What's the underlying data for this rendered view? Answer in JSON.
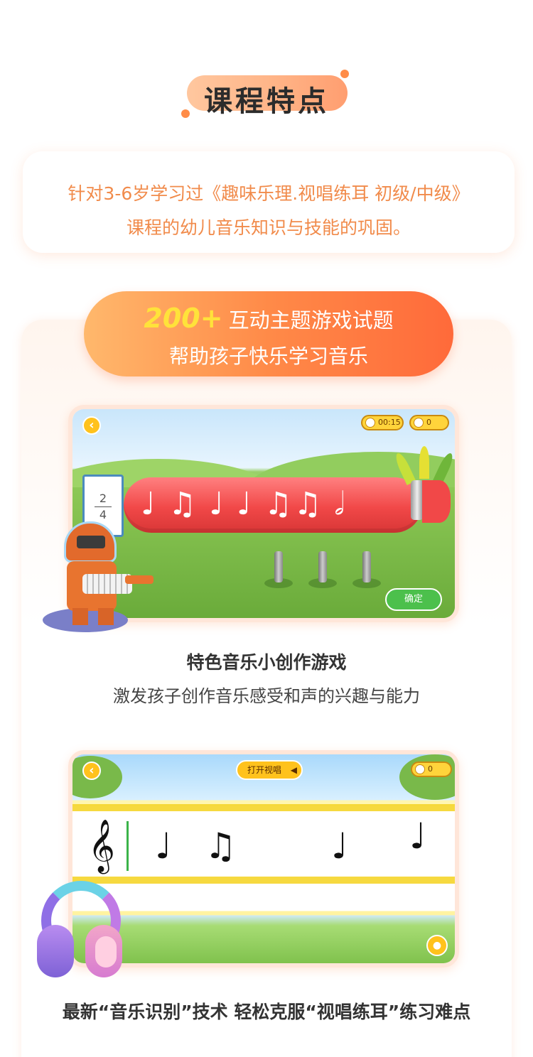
{
  "section_title": "课程特点",
  "description": {
    "line1": "针对3-6岁学习过《趣味乐理.视唱练耳 初级/中级》",
    "line2": "课程的幼儿音乐知识与技能的巩固。"
  },
  "promo": {
    "number": "200+",
    "line1": "互动主题游戏试题",
    "line2": "帮助孩子快乐学习音乐"
  },
  "game1": {
    "timer": "00:15",
    "score": "0",
    "time_signature_top": "2",
    "time_signature_bottom": "4",
    "notes": "♩ ♫ ♩ ♩  ♫♫ 𝅗𝅥",
    "confirm_label": "确定",
    "back_icon": "chevron-left-icon",
    "title": "特色音乐小创作游戏",
    "subtitle": "激发孩子创作音乐感受和声的兴趣与能力"
  },
  "game2": {
    "sing_label": "打开视唱",
    "score": "0",
    "clef": "𝄞",
    "notes": [
      "♩",
      "♫",
      "♩",
      "♩"
    ],
    "caption": "最新“音乐识别”技术  轻松克服“视唱练耳”练习难点"
  },
  "colors": {
    "accent_orange": "#ff8a48",
    "desc_text": "#f18b4b",
    "promo_number": "#ffe23a",
    "confirm_green": "#4cc04c"
  }
}
